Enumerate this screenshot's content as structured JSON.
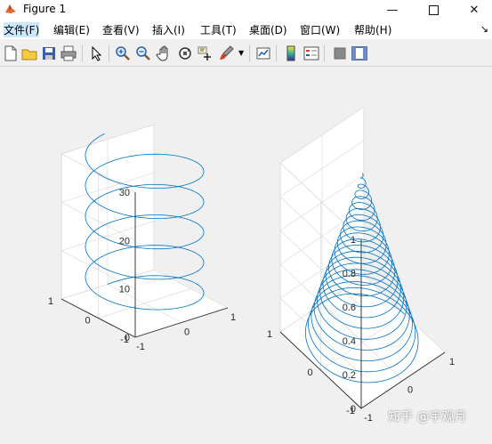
{
  "window": {
    "title": "Figure 1"
  },
  "menu": {
    "items": [
      {
        "label": "文件(F)"
      },
      {
        "label": "编辑(E)"
      },
      {
        "label": "查看(V)"
      },
      {
        "label": "插入(I)"
      },
      {
        "label": "工具(T)"
      },
      {
        "label": "桌面(D)"
      },
      {
        "label": "窗口(W)"
      },
      {
        "label": "帮助(H)"
      }
    ],
    "overflow_arrow": "↘"
  },
  "toolbar": {
    "icons": [
      "new-figure-icon",
      "open-file-icon",
      "save-icon",
      "print-icon",
      "select-pointer-icon",
      "zoom-in-icon",
      "zoom-out-icon",
      "pan-hand-icon",
      "rotate-3d-icon",
      "data-cursor-icon",
      "brush-icon",
      "link-plot-icon",
      "colorbar-icon",
      "legend-icon",
      "hide-plot-tools-icon",
      "show-plot-tools-icon"
    ]
  },
  "chart_data": [
    {
      "type": "line3d",
      "title": "",
      "description_note": "helix",
      "x_ticks": [
        "-1",
        "0",
        "1"
      ],
      "y_ticks": [
        "-1",
        "0",
        "1"
      ],
      "z_ticks": [
        "0",
        "10",
        "20",
        "30"
      ],
      "xlim": [
        -1,
        1
      ],
      "ylim": [
        -1,
        1
      ],
      "zlim": [
        0,
        30
      ],
      "series": [
        {
          "t_range": [
            0,
            31.4
          ],
          "x": "sin(t)",
          "y": "cos(t)",
          "z": "t",
          "color": "#0072bd"
        }
      ]
    },
    {
      "type": "line3d",
      "title": "",
      "x_ticks": [
        "-1",
        "0",
        "1"
      ],
      "y_ticks": [
        "-1",
        "0",
        "1"
      ],
      "z_ticks": [
        "0",
        "0.2",
        "0.4",
        "0.6",
        "0.8",
        "1"
      ],
      "xlim": [
        -1,
        1
      ],
      "ylim": [
        -1,
        1
      ],
      "zlim": [
        0,
        1
      ],
      "series": [
        {
          "t_range": [
            0,
            1
          ],
          "turns": 20,
          "x": "(1-t)cos",
          "y": "(1-t)sin",
          "z": "t",
          "color": "#0072bd"
        }
      ]
    }
  ],
  "watermark": "知乎 @宇观月",
  "colors": {
    "line": "#0072bd",
    "grid": "#dcdcdc",
    "axis": "#262626"
  }
}
